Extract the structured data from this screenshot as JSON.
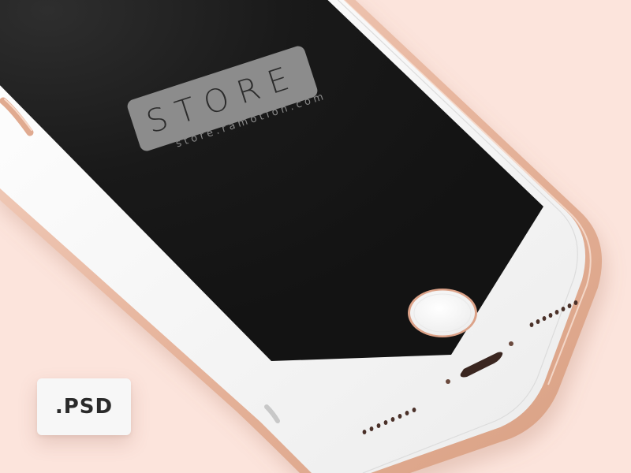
{
  "mockup": {
    "logo_text": "STORE",
    "logo_url": "store.ramotion.com",
    "format_badge": ".PSD"
  },
  "colors": {
    "background": "#fce4dc",
    "frame_gold": "#e6b49c",
    "screen": "#161616",
    "bezel": "#f2f2f2",
    "logo_tile": "#8c8c8c"
  },
  "icons": {
    "home_button": "home-button-icon",
    "speaker": "speaker-grille-icon"
  }
}
